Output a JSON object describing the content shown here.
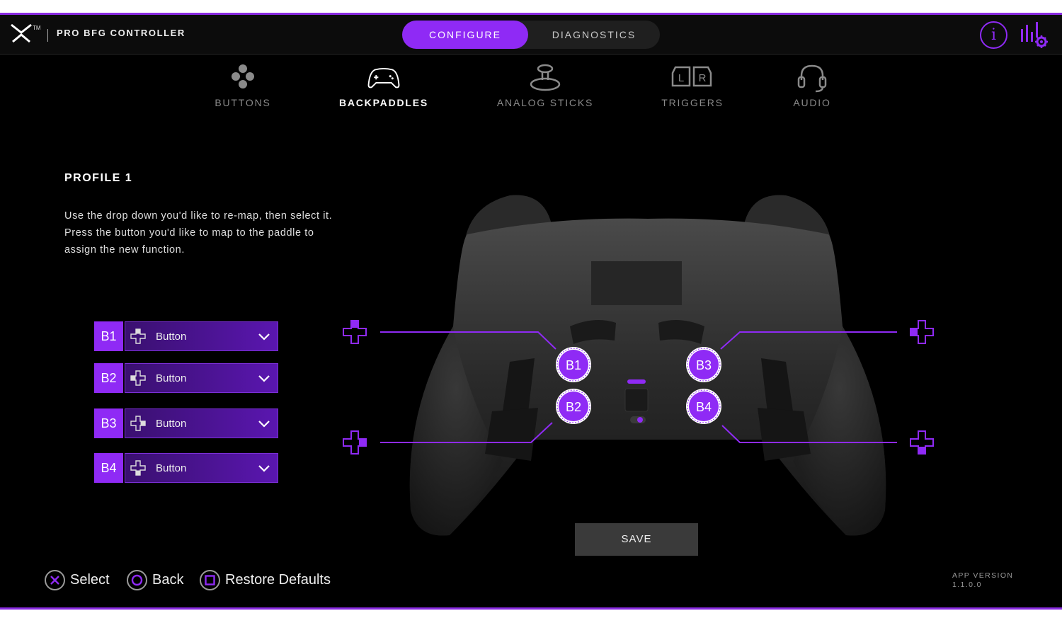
{
  "header": {
    "title": "PRO BFG CONTROLLER",
    "tm": "TM",
    "tabs": [
      {
        "label": "CONFIGURE",
        "active": true
      },
      {
        "label": "DIAGNOSTICS",
        "active": false
      }
    ],
    "info_icon": "i"
  },
  "categories": [
    {
      "label": "BUTTONS",
      "icon": "buttons-icon",
      "active": false
    },
    {
      "label": "BACKPADDLES",
      "icon": "backpaddles-controller-icon",
      "active": true
    },
    {
      "label": "ANALOG STICKS",
      "icon": "analog-stick-icon",
      "active": false
    },
    {
      "label": "TRIGGERS",
      "icon": "triggers-lr-icon",
      "active": false
    },
    {
      "label": "AUDIO",
      "icon": "headset-icon",
      "active": false
    }
  ],
  "trigger_letters": {
    "left": "L",
    "right": "R"
  },
  "profile": {
    "title": "PROFILE 1",
    "instructions": "Use the drop down you'd like to re-map, then select it. Press the button you'd like to map to the paddle to assign the new function."
  },
  "mappings": [
    {
      "paddle": "B1",
      "value": "Button"
    },
    {
      "paddle": "B2",
      "value": "Button"
    },
    {
      "paddle": "B3",
      "value": "Button"
    },
    {
      "paddle": "B4",
      "value": "Button"
    }
  ],
  "paddle_markers": [
    "B1",
    "B2",
    "B3",
    "B4"
  ],
  "save_label": "SAVE",
  "footer": {
    "hints": [
      {
        "label": "Select",
        "symbol": "cross"
      },
      {
        "label": "Back",
        "symbol": "circle"
      },
      {
        "label": "Restore Defaults",
        "symbol": "square"
      }
    ],
    "version_label": "APP VERSION",
    "version_value": "1.1.0.0"
  },
  "colors": {
    "accent": "#8f2af5",
    "background": "#000000",
    "topbar": "#0c0c0c"
  }
}
